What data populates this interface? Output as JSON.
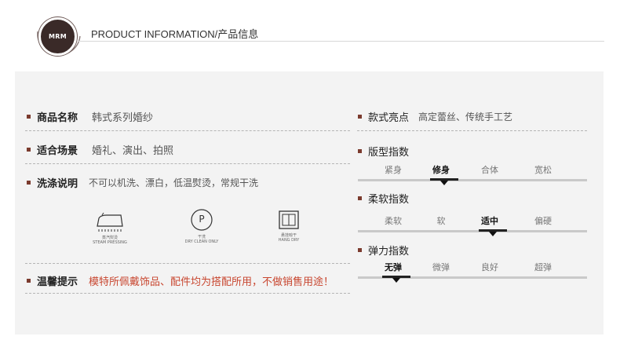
{
  "header": {
    "logo_text": "MRM",
    "title": "PRODUCT INFORMATION/产品信息"
  },
  "left": {
    "name": {
      "label": "商品名称",
      "value": "韩式系列婚纱"
    },
    "occasion": {
      "label": "适合场景",
      "value": "婚礼、演出、拍照"
    },
    "wash": {
      "label": "洗涤说明",
      "value": "不可以机洗、漂白，低温熨烫，常规干洗"
    },
    "care_icons": [
      {
        "icon": "steam-iron-icon",
        "cap1": "蒸汽熨烫",
        "cap2": "STEAM PRESSING"
      },
      {
        "icon": "dry-clean-icon",
        "glyph": "P",
        "cap1": "干洗",
        "cap2": "DRY CLEAN ONLY"
      },
      {
        "icon": "hang-dry-icon",
        "cap1": "悬挂晾干",
        "cap2": "HANG DRY"
      }
    ],
    "notice": {
      "label": "温馨提示",
      "value": "模特所佩戴饰品、配件均为搭配所用，不做销售用途！"
    }
  },
  "right": {
    "highlight": {
      "label": "款式亮点",
      "value": "高定蕾丝、传统手工艺"
    },
    "fit": {
      "label": "版型指数",
      "options": [
        "紧身",
        "修身",
        "合体",
        "宽松"
      ],
      "selected_index": 1
    },
    "softness": {
      "label": "柔软指数",
      "options": [
        "柔软",
        "软",
        "适中",
        "偏硬"
      ],
      "selected_index": 2
    },
    "elasticity": {
      "label": "弹力指数",
      "options": [
        "无弹",
        "微弹",
        "良好",
        "超弹"
      ],
      "selected_index": 0
    }
  },
  "colors": {
    "accent_square": "#7b3b2e",
    "warning_text": "#c8462f",
    "panel_bg": "#f3f3f3"
  }
}
